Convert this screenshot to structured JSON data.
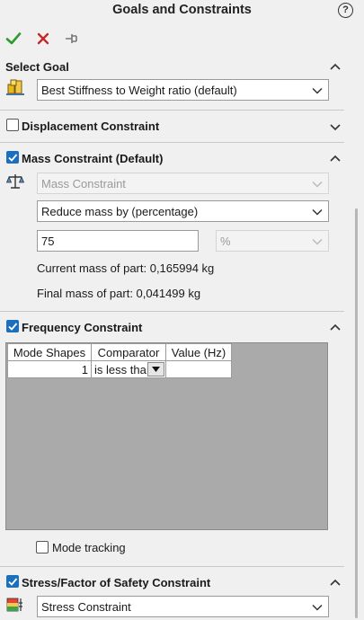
{
  "panel": {
    "title": "Goals and Constraints",
    "help": "?"
  },
  "toolbar": {
    "ok": "ok-check-icon",
    "cancel": "cancel-x-icon",
    "pin": "pin-icon"
  },
  "select_goal": {
    "header": "Select Goal",
    "goal_value": "Best Stiffness to Weight ratio (default)"
  },
  "displacement": {
    "header": "Displacement Constraint",
    "checked": false
  },
  "mass": {
    "header": "Mass Constraint (Default)",
    "checked": true,
    "type_value": "Mass Constraint",
    "reduce_value": "Reduce mass by (percentage)",
    "amount_value": "75",
    "unit_value": "%",
    "current_mass": "Current mass of part: 0,165994 kg",
    "final_mass": "Final mass of part: 0,041499 kg"
  },
  "frequency": {
    "header": "Frequency Constraint",
    "checked": true,
    "columns": [
      "Mode Shapes",
      "Comparator",
      "Value (Hz)"
    ],
    "rows": [
      {
        "mode": "1",
        "comparator": "is less tha",
        "value": ""
      }
    ],
    "mode_tracking_label": "Mode tracking",
    "mode_tracking_checked": false
  },
  "stress": {
    "header": "Stress/Factor of Safety Constraint",
    "checked": true,
    "type_value": "Stress Constraint"
  },
  "colors": {
    "check_blue": "#1a6fbf",
    "ok_green": "#2e9a2e",
    "cancel_red": "#c62828",
    "grid_gray": "#aaaaaa"
  }
}
